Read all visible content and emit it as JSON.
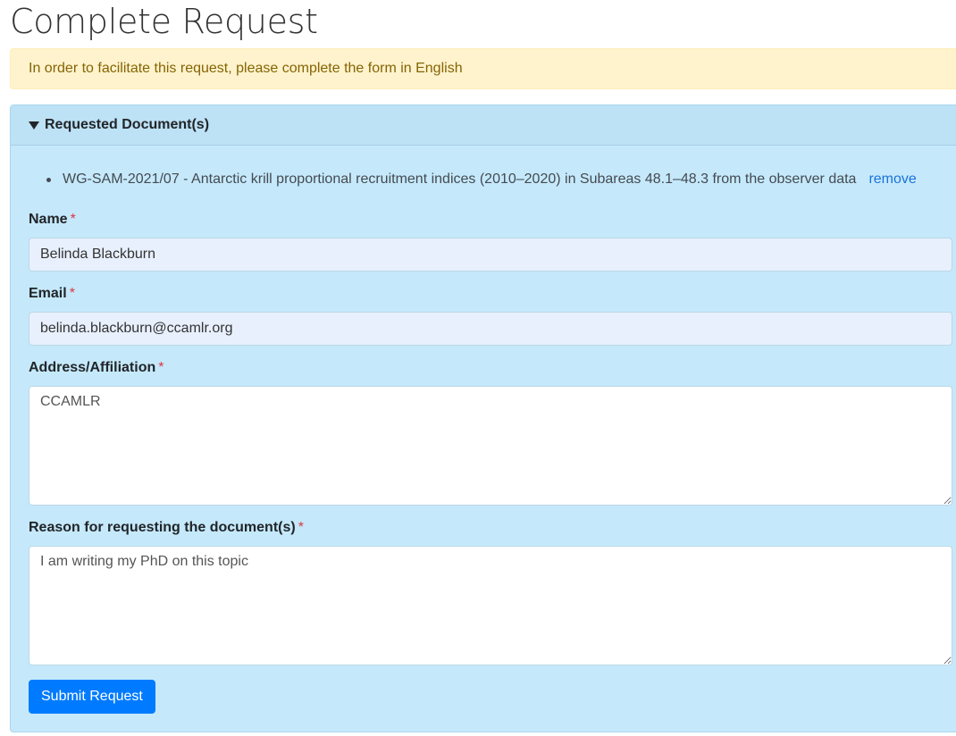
{
  "page": {
    "title": "Complete Request"
  },
  "alert": {
    "text": "In order to facilitate this request, please complete the form in English"
  },
  "requested": {
    "header": "Requested Document(s)",
    "documents": [
      {
        "title": "WG-SAM-2021/07 - Antarctic krill proportional recruitment indices (2010–2020) in Subareas 48.1–48.3 from the observer data",
        "remove_label": "remove"
      }
    ]
  },
  "form": {
    "required_marker": "*",
    "name": {
      "label": "Name",
      "value": "Belinda Blackburn"
    },
    "email": {
      "label": "Email",
      "value": "belinda.blackburn@ccamlr.org"
    },
    "address": {
      "label": "Address/Affiliation",
      "value": "CCAMLR"
    },
    "reason": {
      "label": "Reason for requesting the document(s)",
      "value": "I am writing my PhD on this topic"
    },
    "submit_label": "Submit Request"
  },
  "colors": {
    "alert_bg": "#fff3cd",
    "card_bg": "#c5e9fb",
    "primary": "#007bff",
    "required": "#dc3545"
  }
}
